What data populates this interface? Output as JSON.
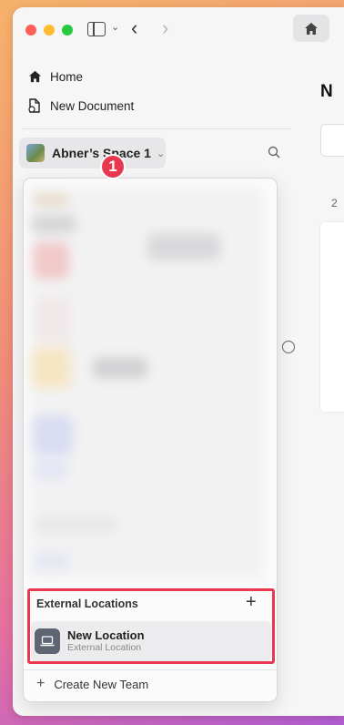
{
  "titlebar": {
    "nav_back": "‹",
    "nav_forward": "›"
  },
  "sidebar": {
    "items": [
      {
        "label": "Home",
        "icon": "house-icon"
      },
      {
        "label": "New Document",
        "icon": "new-document-icon"
      }
    ],
    "space": {
      "name": "Abner’s Space 1",
      "badge": "1"
    }
  },
  "main_peek": {
    "title": "N",
    "number": "2"
  },
  "popup": {
    "section_title": "External Locations",
    "location": {
      "name": "New Location",
      "subtitle": "External Location"
    },
    "create_team_label": "Create New Team"
  },
  "colors": {
    "highlight": "#e8384f",
    "badge": "#e8384f",
    "location_icon_bg": "#5f6573"
  }
}
